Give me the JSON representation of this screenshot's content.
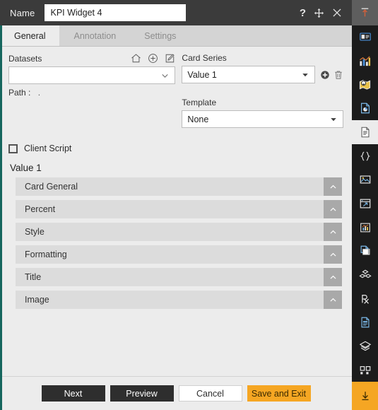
{
  "titlebar": {
    "label": "Name",
    "widget_name": "KPI Widget 4",
    "widget_name_placeholder": "Name",
    "help_glyph": "?",
    "icons": [
      "help-icon",
      "move-icon",
      "close-icon"
    ]
  },
  "tabs": [
    {
      "label": "General",
      "active": true
    },
    {
      "label": "Annotation",
      "active": false
    },
    {
      "label": "Settings",
      "active": false
    }
  ],
  "datasets": {
    "label": "Datasets",
    "value": "",
    "placeholder": "",
    "icons": [
      "home-icon",
      "add-circle-icon",
      "edit-icon"
    ]
  },
  "path": {
    "label": "Path :",
    "value": "."
  },
  "card_series": {
    "label": "Card Series",
    "value": "Value 1",
    "options": [
      "Value 1"
    ],
    "add_icon": "add-circle-filled-icon",
    "delete_icon": "trash-icon"
  },
  "template": {
    "label": "Template",
    "value": "None",
    "options": [
      "None"
    ]
  },
  "client_script": {
    "label": "Client Script",
    "checked": false
  },
  "value_section": {
    "title": "Value 1"
  },
  "accordion": [
    {
      "label": "Card General",
      "collapse_icon": "chevron-up-icon"
    },
    {
      "label": "Percent",
      "collapse_icon": "chevron-up-icon"
    },
    {
      "label": "Style",
      "collapse_icon": "chevron-up-icon"
    },
    {
      "label": "Formatting",
      "collapse_icon": "chevron-up-icon"
    },
    {
      "label": "Title",
      "collapse_icon": "chevron-up-icon"
    },
    {
      "label": "Image",
      "collapse_icon": "chevron-up-icon"
    }
  ],
  "footer": {
    "next": "Next",
    "preview": "Preview",
    "cancel": "Cancel",
    "save_and_exit": "Save and Exit"
  },
  "sidebar": {
    "pin_icon": "pin-up-icon",
    "items": [
      {
        "icon": "card-widget-icon",
        "selected": false
      },
      {
        "icon": "bar-chart-icon",
        "selected": false
      },
      {
        "icon": "map-pin-icon",
        "selected": false
      },
      {
        "icon": "report-chart-icon",
        "selected": false
      },
      {
        "icon": "document-icon",
        "selected": true
      },
      {
        "icon": "code-braces-icon",
        "selected": false
      },
      {
        "icon": "image-icon",
        "selected": false
      },
      {
        "icon": "frame-window-icon",
        "selected": false
      },
      {
        "icon": "line-chart-icon",
        "selected": false
      },
      {
        "icon": "copy-pages-icon",
        "selected": false
      },
      {
        "icon": "cubes-icon",
        "selected": false
      },
      {
        "icon": "prescription-icon",
        "selected": false
      },
      {
        "icon": "form-document-icon",
        "selected": false
      },
      {
        "icon": "layers-icon",
        "selected": false
      },
      {
        "icon": "grid-blocks-icon",
        "selected": false
      }
    ],
    "download_icon": "download-icon"
  },
  "colors": {
    "accent_orange": "#f5a623",
    "header_dark": "#3b3b3b",
    "panel_bg": "#ececec",
    "accordion_bg": "#dcdcdc",
    "left_accent": "#16665e"
  }
}
